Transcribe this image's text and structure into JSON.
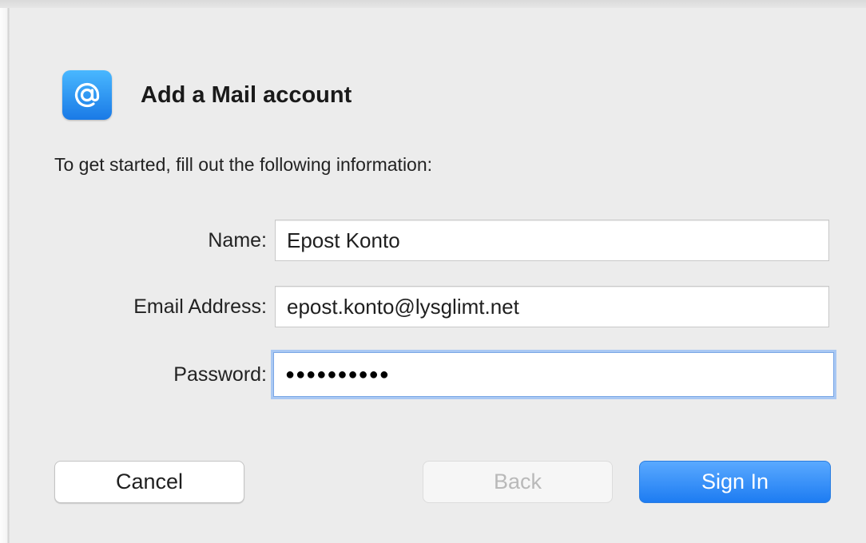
{
  "dialog": {
    "title": "Add a Mail account",
    "icon": "at-sign-mail-icon",
    "intro": "To get started, fill out the following information:"
  },
  "fields": {
    "name": {
      "label": "Name:",
      "value": "Epost Konto"
    },
    "email": {
      "label": "Email Address:",
      "value": "epost.konto@lysglimt.net"
    },
    "password": {
      "label": "Password:",
      "value": "●●●●●●●●●●"
    }
  },
  "buttons": {
    "cancel": "Cancel",
    "back": "Back",
    "sign_in": "Sign In"
  },
  "colors": {
    "accent": "#1d7cf2",
    "background": "#ececec",
    "focus_ring": "#a9c8f3"
  }
}
